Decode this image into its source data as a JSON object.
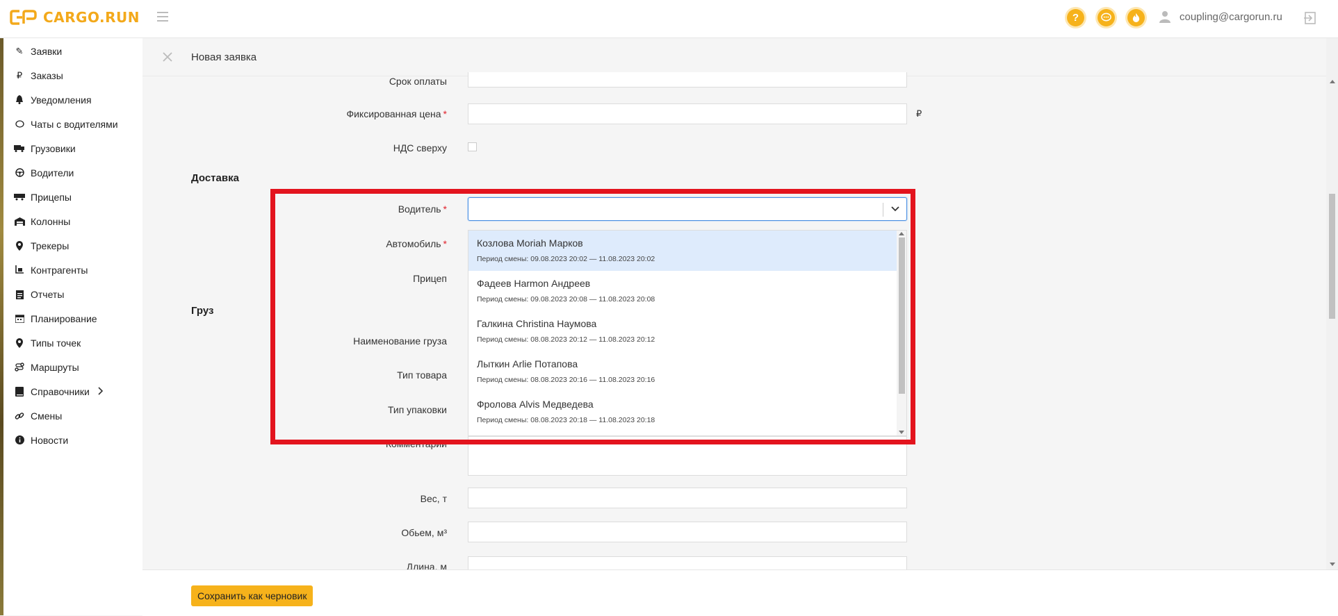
{
  "app": {
    "logo_text": "CARGO.RUN",
    "brand_color": "#f3a91b",
    "user_email": "coupling@cargorun.ru"
  },
  "header_icons": [
    {
      "name": "help-icon",
      "glyph": "?"
    },
    {
      "name": "chat-icon",
      "glyph": "…"
    },
    {
      "name": "fire-icon",
      "glyph": "♨"
    }
  ],
  "sidebar": {
    "items": [
      {
        "label": "Заявки",
        "icon": "edit-icon",
        "glyph": "✎"
      },
      {
        "label": "Заказы",
        "icon": "ruble-icon",
        "glyph": "₽"
      },
      {
        "label": "Уведомления",
        "icon": "bell-icon",
        "glyph": "🔔"
      },
      {
        "label": "Чаты с водителями",
        "icon": "chat-icon",
        "glyph": "💬"
      },
      {
        "label": "Грузовики",
        "icon": "truck-icon",
        "glyph": "⛟"
      },
      {
        "label": "Водители",
        "icon": "steering-wheel-icon",
        "glyph": "⊛"
      },
      {
        "label": "Прицепы",
        "icon": "trailer-icon",
        "glyph": "▬"
      },
      {
        "label": "Колонны",
        "icon": "warehouse-icon",
        "glyph": "⌂"
      },
      {
        "label": "Трекеры",
        "icon": "map-pin-icon",
        "glyph": "●"
      },
      {
        "label": "Контрагенты",
        "icon": "dolly-icon",
        "glyph": "⊡"
      },
      {
        "label": "Отчеты",
        "icon": "clipboard-icon",
        "glyph": "▤"
      },
      {
        "label": "Планирование",
        "icon": "calendar-icon",
        "glyph": "▦"
      },
      {
        "label": "Типы точек",
        "icon": "map-pin-icon",
        "glyph": "●"
      },
      {
        "label": "Маршруты",
        "icon": "route-icon",
        "glyph": "∿"
      },
      {
        "label": "Справочники",
        "icon": "book-icon",
        "glyph": "▮",
        "has_submenu": true
      },
      {
        "label": "Смены",
        "icon": "link-icon",
        "glyph": "⚭"
      },
      {
        "label": "Новости",
        "icon": "info-icon",
        "glyph": "ℹ"
      }
    ]
  },
  "page": {
    "title": "Новая заявка"
  },
  "form": {
    "payment_term_label": "Срок оплаты",
    "fixed_price_label": "Фиксированная цена",
    "currency_symbol": "₽",
    "vat_label": "НДС сверху",
    "delivery_section": "Доставка",
    "driver_label": "Водитель",
    "car_label": "Автомобиль",
    "trailer_label": "Прицеп",
    "cargo_section": "Груз",
    "cargo_name_label": "Наименование груза",
    "goods_type_label": "Тип товара",
    "package_type_label": "Тип упаковки",
    "comment_label": "Комментарий",
    "weight_label": "Вес, т",
    "volume_label": "Обьем, м³",
    "length_label": "Длина, м"
  },
  "driver_dropdown": {
    "options": [
      {
        "name": "Козлова Moriah Марков",
        "shift": "Период смены: 09.08.2023 20:02 — 11.08.2023 20:02",
        "highlighted": true
      },
      {
        "name": "Фадеев Harmon Андреев",
        "shift": "Период смены: 09.08.2023 20:08 — 11.08.2023 20:08"
      },
      {
        "name": "Галкина Christina Наумова",
        "shift": "Период смены: 08.08.2023 20:12 — 11.08.2023 20:12"
      },
      {
        "name": "Лыткин Arlie Потапова",
        "shift": "Период смены: 08.08.2023 20:16 — 11.08.2023 20:16"
      },
      {
        "name": "Фролова Alvis Медведева",
        "shift": "Период смены: 08.08.2023 20:18 — 11.08.2023 20:18"
      }
    ]
  },
  "footer": {
    "save_draft_label": "Сохранить как черновик"
  }
}
